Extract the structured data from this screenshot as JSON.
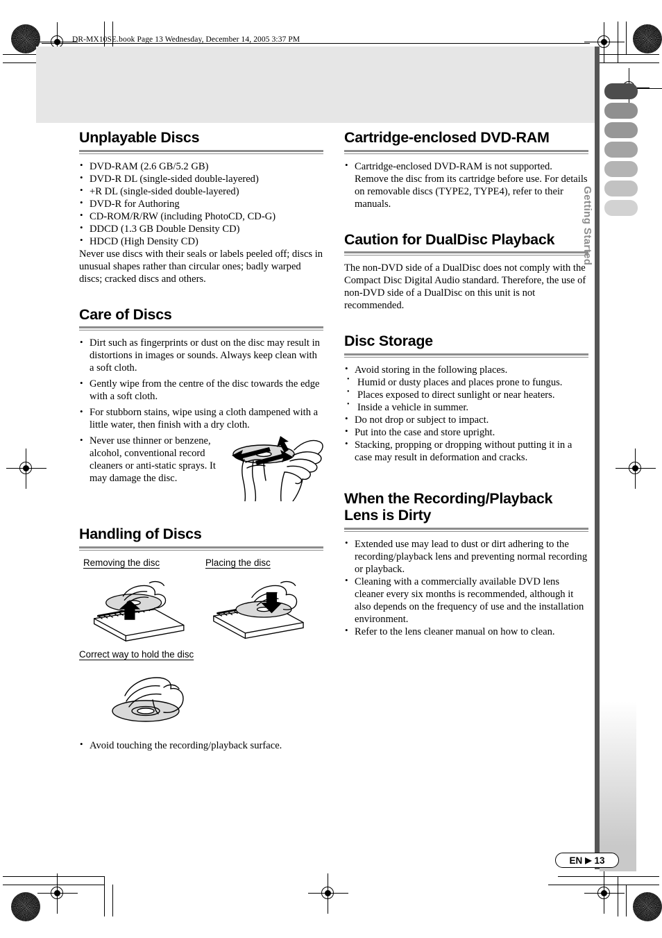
{
  "header": {
    "book_info": "DR-MX10SE.book  Page 13  Wednesday, December 14, 2005  3:37 PM"
  },
  "thumb_index": {
    "label": "Getting Started"
  },
  "footer": {
    "lang": "EN",
    "arrow": "▶",
    "page": "13"
  },
  "left_column": {
    "unplayable": {
      "heading": "Unplayable Discs",
      "items": [
        "DVD-RAM (2.6 GB/5.2 GB)",
        "DVD-R DL (single-sided double-layered)",
        "+R DL (single-sided double-layered)",
        "DVD-R for Authoring",
        "CD-ROM/R/RW (including PhotoCD, CD-G)",
        "DDCD (1.3 GB Double Density CD)",
        "HDCD (High Density CD)"
      ],
      "note": "Never use discs with their seals or labels peeled off; discs in unusual shapes rather than circular ones; badly warped discs; cracked discs and others."
    },
    "care": {
      "heading": "Care of Discs",
      "items": [
        "Dirt such as fingerprints or dust on the disc may result in distortions in images or sounds. Always keep clean with a soft cloth.",
        "Gently wipe from the centre of the disc towards the edge with a soft cloth.",
        "For stubborn stains, wipe using a cloth dampened with a little water, then finish with a dry cloth.",
        "Never use thinner or benzene, alcohol, conventional record cleaners or anti-static sprays. It may damage the disc."
      ]
    },
    "handling": {
      "heading": "Handling of Discs",
      "fig_removing_label": "Removing the disc",
      "fig_placing_label": "Placing the disc",
      "fig_hold_label": "Correct way to hold the disc",
      "note_item": "Avoid touching the recording/playback surface."
    }
  },
  "right_column": {
    "cartridge": {
      "heading": "Cartridge-enclosed DVD-RAM",
      "items": [
        "Cartridge-enclosed DVD-RAM is not supported. Remove the disc from its cartridge before use. For details on removable discs (TYPE2, TYPE4), refer to their manuals."
      ]
    },
    "dualdisc": {
      "heading": "Caution for DualDisc Playback",
      "body": "The non-DVD side of a DualDisc does not comply with the Compact Disc Digital Audio standard. Therefore, the use of non-DVD side of a DualDisc on this unit is not recommended."
    },
    "storage": {
      "heading": "Disc Storage",
      "item1": "Avoid storing in the following places.",
      "sub_items": [
        "Humid or dusty places and places prone to fungus.",
        "Places exposed to direct sunlight or near heaters.",
        "Inside a vehicle in summer."
      ],
      "items_rest": [
        "Do not drop or subject to impact.",
        "Put into the case and store upright.",
        "Stacking, propping or dropping without putting it in a case may result in deformation and cracks."
      ]
    },
    "lens": {
      "heading": "When the Recording/Playback Lens is Dirty",
      "items": [
        "Extended use may lead to dust or dirt adhering to the recording/playback lens and preventing normal recording or playback.",
        "Cleaning with a commercially available DVD lens cleaner every six months is recommended, although it also depends on the frequency of use and the installation environment.",
        "Refer to the lens cleaner manual on how to clean."
      ]
    }
  },
  "colors": {
    "rule_grey": "#8c8c8c",
    "band_grey": "#e6e6e6",
    "right_rule": "#555555",
    "tab_shades": [
      "#4d4d4d",
      "#8f8f8f",
      "#979797",
      "#a4a4a4",
      "#b4b4b4",
      "#c2c2c2",
      "#d2d2d2"
    ]
  }
}
